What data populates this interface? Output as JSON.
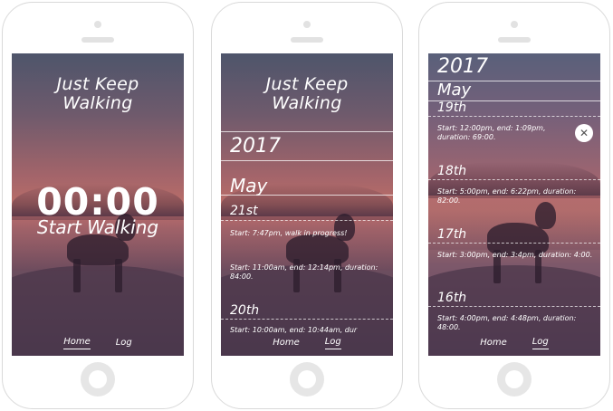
{
  "app": {
    "title_line1": "Just Keep",
    "title_line2": "Walking"
  },
  "nav": {
    "home": "Home",
    "log": "Log"
  },
  "home_screen": {
    "timer": "00:00",
    "start_label": "Start Walking"
  },
  "log_screen_a": {
    "year": "2017",
    "month": "May",
    "days": [
      {
        "day": "21st",
        "entries": [
          "Start: 7:47pm, walk in progress!",
          "Start: 11:00am, end: 12:14pm, duration: 84:00."
        ]
      },
      {
        "day": "20th",
        "entries": [
          "Start: 10:00am, end: 10:44am, dur"
        ]
      }
    ]
  },
  "log_screen_b": {
    "year": "2017",
    "month": "May",
    "close_icon": "close-icon",
    "days": [
      {
        "day": "19th",
        "entry": "Start: 12:00pm, end: 1:09pm, duration: 69:00."
      },
      {
        "day": "18th",
        "entry": "Start: 5:00pm, end: 6:22pm, duration: 82:00."
      },
      {
        "day": "17th",
        "entry": "Start: 3:00pm, end: 3:4pm, duration: 4:00."
      },
      {
        "day": "16th",
        "entry": "Start: 4:00pm, end: 4:48pm, duration: 48:00."
      }
    ]
  }
}
